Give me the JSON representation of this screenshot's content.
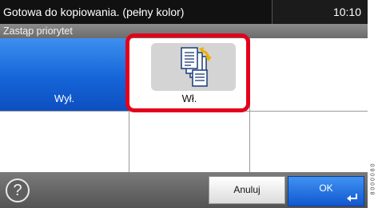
{
  "status": {
    "message": "Gotowa do kopiowania. (pełny kolor)",
    "time": "10:10"
  },
  "title": "Zastąp priorytet",
  "options": [
    {
      "label": "Wył.",
      "selected": true
    },
    {
      "label": "Wł.",
      "selected": false,
      "icon": "copy-documents-icon",
      "highlighted": true
    }
  ],
  "footer": {
    "help_label": "?",
    "cancel_label": "Anuluj",
    "ok_label": "OK"
  },
  "side_code": "8 0 0 0 0 8 0"
}
